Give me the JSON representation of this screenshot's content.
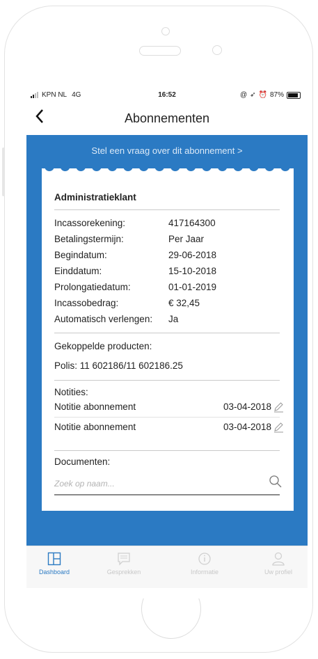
{
  "status_bar": {
    "carrier": "KPN NL",
    "network": "4G",
    "time": "16:52",
    "battery": "87%"
  },
  "nav": {
    "title": "Abonnementen"
  },
  "banner": {
    "ask_label": "Stel een vraag over dit abonnement >"
  },
  "card": {
    "heading": "Administratieklant",
    "fields": [
      {
        "label": "Incassorekening:",
        "value": "417164300"
      },
      {
        "label": "Betalingstermijn:",
        "value": "Per Jaar"
      },
      {
        "label": "Begindatum:",
        "value": "29-06-2018"
      },
      {
        "label": "Einddatum:",
        "value": "15-10-2018"
      },
      {
        "label": "Prolongatiedatum:",
        "value": "01-01-2019"
      },
      {
        "label": "Incassobedrag:",
        "value": "€ 32,45"
      },
      {
        "label": "Automatisch verlengen:",
        "value": "Ja"
      }
    ],
    "linked_heading": "Gekoppelde producten:",
    "linked_policy": "Polis: 11 602186/11 602186.25",
    "notes_heading": "Notities:",
    "notes": [
      {
        "title": "Notitie abonnement",
        "date": "03-04-2018"
      },
      {
        "title": "Notitie abonnement",
        "date": "03-04-2018"
      }
    ],
    "documents_heading": "Documenten:",
    "search_placeholder": "Zoek op naam..."
  },
  "tabs": [
    {
      "label": "Dashboard",
      "icon": "dashboard-icon",
      "active": true
    },
    {
      "label": "Gesprekken",
      "icon": "chat-icon",
      "active": false
    },
    {
      "label": "Informatie",
      "icon": "info-icon",
      "active": false
    },
    {
      "label": "Uw profiel",
      "icon": "user-icon",
      "active": false
    }
  ],
  "colors": {
    "brand_blue": "#2b7ac3",
    "tab_inactive": "#c8c8c8"
  }
}
